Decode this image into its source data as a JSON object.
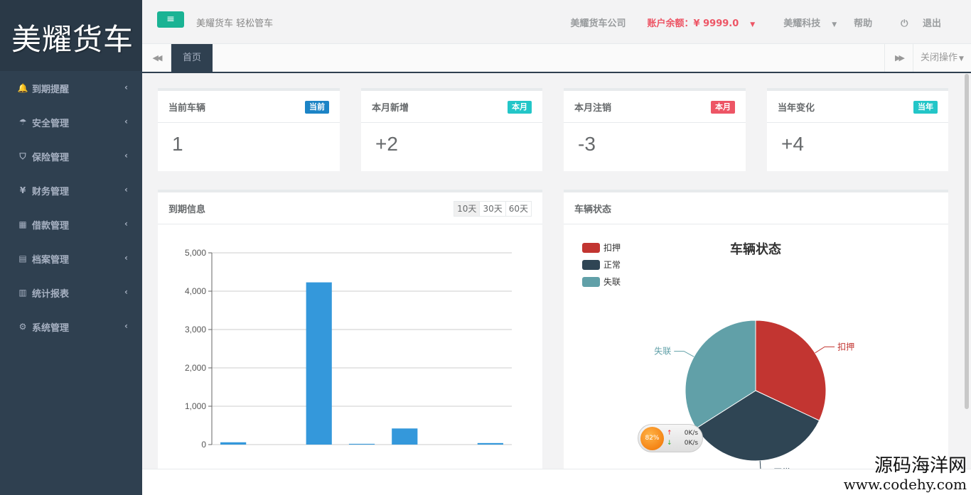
{
  "sidebar": {
    "logo": "美耀货车",
    "items": [
      {
        "label": "到期提醒",
        "icon": "bell-icon",
        "glyph": "🔔"
      },
      {
        "label": "安全管理",
        "icon": "umbrella-icon",
        "glyph": "☂"
      },
      {
        "label": "保险管理",
        "icon": "shield-icon",
        "glyph": "⛉"
      },
      {
        "label": "财务管理",
        "icon": "yen-icon",
        "glyph": "¥"
      },
      {
        "label": "借款管理",
        "icon": "calculator-icon",
        "glyph": "▦"
      },
      {
        "label": "档案管理",
        "icon": "file-icon",
        "glyph": "▤"
      },
      {
        "label": "统计报表",
        "icon": "bar-chart-icon",
        "glyph": "▥"
      },
      {
        "label": "系统管理",
        "icon": "gear-icon",
        "glyph": "⚙"
      }
    ]
  },
  "header": {
    "menu_icon": "≡",
    "slogan": "美耀货车 轻松管车",
    "company": "美耀货车公司",
    "balance": "账户余额：¥ 9999.0",
    "org": "美耀科技",
    "help": "帮助",
    "logout": "退出"
  },
  "tabs": {
    "active": "首页",
    "close_ops": "关闭操作"
  },
  "stats": [
    {
      "title": "当前车辆",
      "badge": "当前",
      "badge_color": "#1c84c6",
      "value": "1"
    },
    {
      "title": "本月新增",
      "badge": "本月",
      "badge_color": "#23c6c8",
      "value": "+2"
    },
    {
      "title": "本月注销",
      "badge": "本月",
      "badge_color": "#ed5565",
      "value": "-3"
    },
    {
      "title": "当年变化",
      "badge": "当年",
      "badge_color": "#23c6c8",
      "value": "+4"
    }
  ],
  "expiry_panel": {
    "title": "到期信息",
    "ranges": [
      "10天",
      "30天",
      "60天"
    ]
  },
  "status_panel": {
    "title": "车辆状态"
  },
  "chart_data": [
    {
      "type": "bar",
      "title": "",
      "categories": [
        "",
        "",
        "",
        "",
        "",
        "",
        ""
      ],
      "values": [
        60,
        0,
        4230,
        20,
        420,
        0,
        40
      ],
      "ylim": [
        0,
        5000
      ],
      "yticks": [
        "0",
        "1,000",
        "2,000",
        "3,000",
        "4,000",
        "5,000"
      ],
      "color": "#3498db",
      "grid": true
    },
    {
      "type": "pie",
      "title": "车辆状态",
      "legend_position": "top-left",
      "slices": [
        {
          "name": "扣押",
          "value": 32,
          "color": "#c23531"
        },
        {
          "name": "正常",
          "value": 34,
          "color": "#2f4554"
        },
        {
          "name": "失联",
          "value": 34,
          "color": "#61a0a8"
        }
      ]
    }
  ],
  "net_widget": {
    "percent": "82%",
    "up": "0K/s",
    "down": "0K/s"
  },
  "watermark": {
    "line1": "源码海洋网",
    "line2": "www.codehy.com"
  }
}
